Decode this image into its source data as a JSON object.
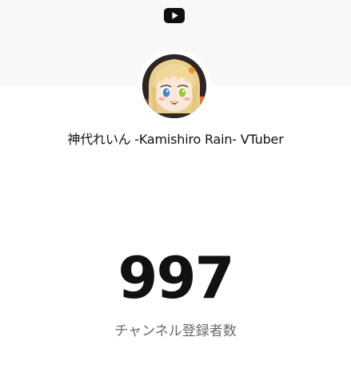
{
  "header": {
    "logo_icon": "youtube-icon",
    "band_color": "#f8f8f8"
  },
  "channel": {
    "name": "神代れいん -Kamishiro Rain- VTuber",
    "avatar": "channel-avatar"
  },
  "stats": {
    "subscriber_count": "997",
    "subscriber_label": "チャンネル登録者数"
  },
  "colors": {
    "logo": "#0f0f0f",
    "text_primary": "#111111",
    "text_secondary": "#6a6a6a"
  }
}
